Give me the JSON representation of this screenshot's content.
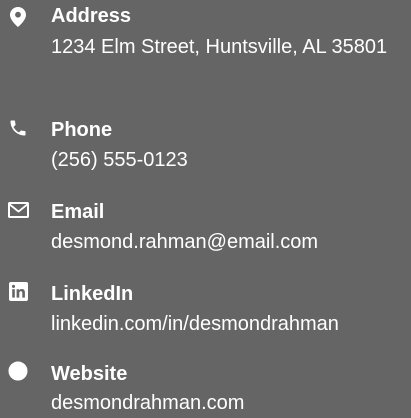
{
  "contacts": [
    {
      "icon": "map-marker-icon",
      "label": "Address",
      "value": "1234 Elm Street, Huntsville, AL 35801"
    },
    {
      "icon": "phone-icon",
      "label": "Phone",
      "value": "(256) 555-0123"
    },
    {
      "icon": "envelope-icon",
      "label": "Email",
      "value": "desmond.rahman@email.com"
    },
    {
      "icon": "linkedin-icon",
      "label": "LinkedIn",
      "value": "linkedin.com/in/desmondrahman"
    },
    {
      "icon": "globe-icon",
      "label": "Website",
      "value": "desmondrahman.com"
    }
  ],
  "colors": {
    "background": "#656565",
    "text": "#ffffff"
  }
}
